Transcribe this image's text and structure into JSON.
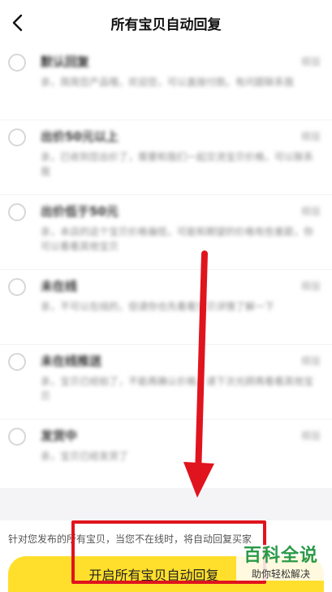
{
  "header": {
    "title": "所有宝贝自动回复",
    "back_icon": "chevron-left-icon"
  },
  "list": [
    {
      "title": "默认回复",
      "tag": "模版",
      "desc": "亲，简简您产品哦，欢迎您，可以直接付款。有问题联系我"
    },
    {
      "title": "出价50元以上",
      "tag": "模版",
      "desc": "亲，已收到您出价了，需要和我们一起交流宝贝价格，可以联系我"
    },
    {
      "title": "出价低于50元",
      "tag": "模版",
      "desc": "亲，本店的这个宝贝价格偏低，可能和期望的价格有些差距，你可以看看其他宝贝"
    },
    {
      "title": "未在线",
      "tag": "模版",
      "desc": "亲，不可以在线的，但请你也先看看宝贝详情了解一下"
    },
    {
      "title": "未在线推送",
      "tag": "模版",
      "desc": "亲，宝贝已经拍了，不能再确认价格，请下次光顾再看看其他宝贝"
    },
    {
      "title": "发货中",
      "tag": "模版",
      "desc": "亲，宝贝已经发货了"
    }
  ],
  "footer": {
    "notice": "针对您发布的所有宝贝，当您不在线时，将自动回复买家",
    "cta_label": "开启所有宝贝自动回复"
  },
  "watermark": {
    "big": "百科全说",
    "small": "助你轻松解决"
  },
  "colors": {
    "accent": "#ffdf2c",
    "annotation": "#e0141e",
    "watermark": "#2a9a48"
  }
}
